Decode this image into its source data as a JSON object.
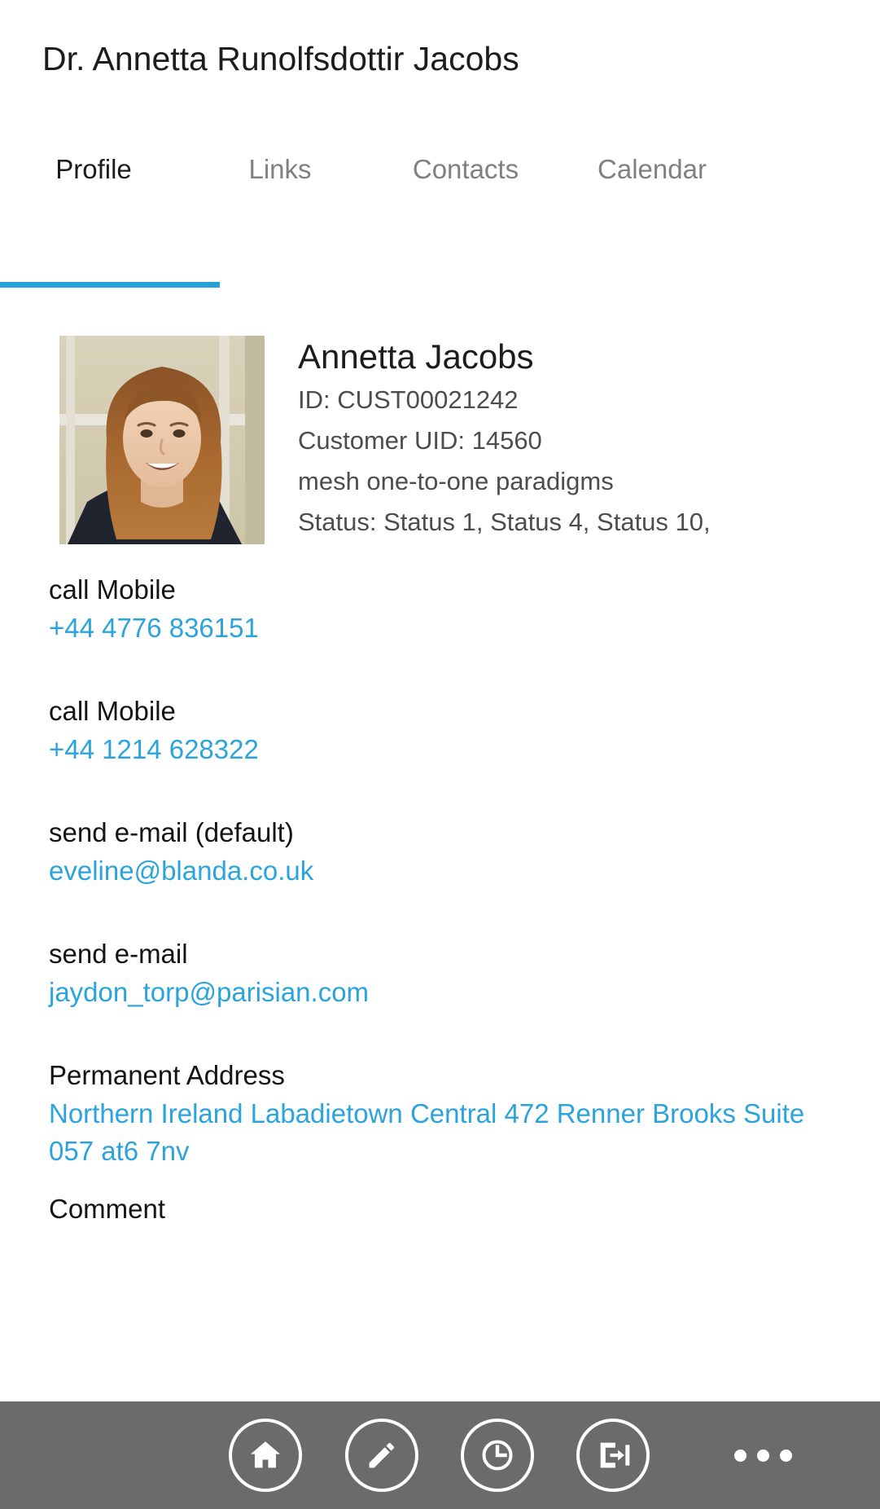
{
  "header": {
    "title": "Dr. Annetta Runolfsdottir Jacobs"
  },
  "tabs": [
    {
      "label": "Profile",
      "active": true
    },
    {
      "label": "Links",
      "active": false
    },
    {
      "label": "Contacts",
      "active": false
    },
    {
      "label": "Calendar",
      "active": false
    }
  ],
  "accent_color": "#26A0DA",
  "link_color": "#2BA3DC",
  "toolbar_color": "#6B6B6B",
  "profile": {
    "avatar_alt": "portrait-photo",
    "name": "Annetta Jacobs",
    "id_line": "ID: CUST00021242",
    "uid_line": "Customer UID: 14560",
    "tagline": "mesh one-to-one paradigms",
    "status_line": "Status: Status 1, Status 4, Status 10,"
  },
  "fields": [
    {
      "label": "call Mobile",
      "value": "+44 4776 836151"
    },
    {
      "label": "call Mobile",
      "value": "+44 1214 628322"
    },
    {
      "label": "send e-mail (default)",
      "value": "eveline@blanda.co.uk"
    },
    {
      "label": "send e-mail",
      "value": "jaydon_torp@parisian.com"
    },
    {
      "label": "Permanent Address",
      "value": "Northern Ireland Labadietown Central 472 Renner Brooks Suite 057 at6 7nv"
    },
    {
      "label": "Comment",
      "value": ""
    }
  ],
  "toolbar": {
    "buttons": [
      {
        "icon": "home-icon",
        "label": "Home"
      },
      {
        "icon": "pencil-icon",
        "label": "Edit"
      },
      {
        "icon": "clock-icon",
        "label": "History"
      },
      {
        "icon": "check-in-icon",
        "label": "Check in"
      }
    ],
    "more_label": "More"
  }
}
